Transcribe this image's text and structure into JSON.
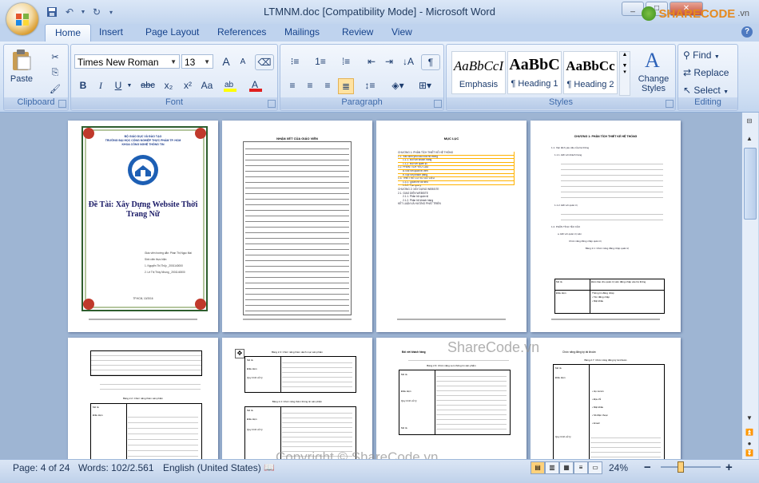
{
  "window": {
    "title": "LTMNM.doc [Compatibility Mode] - Microsoft Word",
    "min": "_",
    "max": "□",
    "close": "✕"
  },
  "watermark": {
    "logo_text": "SHARECODE",
    "logo_suffix": ".vn",
    "center": "ShareCode.vn",
    "copyright": "Copyright © ShareCode.vn"
  },
  "tabs": [
    "Home",
    "Insert",
    "Page Layout",
    "References",
    "Mailings",
    "Review",
    "View"
  ],
  "ribbon": {
    "clipboard": {
      "paste": "Paste",
      "label": "Clipboard"
    },
    "font": {
      "name": "Times New Roman",
      "size": "13",
      "label": "Font",
      "bold": "B",
      "italic": "I",
      "underline": "U",
      "strike": "abc",
      "sub": "x₂",
      "sup": "x²",
      "case": "Aa",
      "grow": "A",
      "shrink": "A"
    },
    "paragraph": {
      "label": "Paragraph"
    },
    "styles": {
      "label": "Styles",
      "items": [
        {
          "preview": "AaBbCcI",
          "name": "Emphasis"
        },
        {
          "preview": "AaBbC",
          "name": "¶ Heading 1"
        },
        {
          "preview": "AaBbCc",
          "name": "¶ Heading 2"
        }
      ],
      "change": [
        "Change",
        "Styles"
      ]
    },
    "editing": {
      "find": "Find",
      "replace": "Replace",
      "select": "Select",
      "label": "Editing"
    }
  },
  "pages": {
    "cover": {
      "ministry": "BỘ GIÁO DỤC VÀ ĐÀO TẠO",
      "school": "TRƯỜNG ĐẠI HỌC CÔNG NGHIỆP THỰC PHẨM TP. HCM",
      "faculty": "KHOA CÔNG NGHỆ THÔNG TIN",
      "title_1": "Đề Tài: Xây Dựng Website Thời",
      "title_2": "Trang Nữ",
      "teacher": "Giáo viên hướng dẫn: Phan Thị Ngọc Mai",
      "students_label": "Sinh viên thực hiện:",
      "student_1": "1. Nguyễn Thị Thủy _2001140000",
      "student_2": "2. Lê Thị Thúy Nhung _2001140000",
      "footer": "TP.HCM, 10/2016"
    },
    "remarks": {
      "heading": "NHẬN XÉT CỦA GIÁO VIÊN"
    },
    "toc": {
      "heading": "MỤC LỤC",
      "entries": [
        "CHƯƠNG 1: PHÂN TÍCH THIẾT KẾ HỆ THỐNG",
        "1.1. Xác định yêu cầu của hệ thống",
        "1.1.1. Đối với khách hàng",
        "1.1.2. Đối với quản trị",
        "1.2. PHÂN TÍCH YÊU CẦU",
        "a. Đối với quản trị viên",
        "b. Đối với khách hàng",
        "1.3. THIẾT KẾ CƠ SỞ DỮ LIỆU",
        "1.3.1. Quan hệ dữ liệu",
        "1.3.2. Tạo query",
        "CHƯƠNG 2: XÂY DỰNG WEBSITE",
        "2.1. GIAO DIỆN WEBSITE",
        "2.1.1. Phân hệ quản trị",
        "2.1.2. Phân hệ khách hàng",
        "KẾT LUẬN VÀ HƯỚNG PHÁT TRIỂN"
      ]
    },
    "chapter": {
      "heading": "CHƯƠNG 1: PHÂN TÍCH THIẾT KẾ HỆ THỐNG",
      "s1": "1.1. Xác định yêu cầu của hệ thống",
      "s11": "1.1.1. Đối với khách hàng",
      "s12": "1.1.2. Đối với quản trị",
      "s2": "1.2. PHÂN TÍCH YÊU CẦU",
      "s2a": "a. Đối với quản trị viên",
      "usecase": "Chức năng đăng nhập quản trị",
      "table_caption": "Bảng 2.1: Chức năng đăng nhập quản trị",
      "cell_a": "Mô tả",
      "cell_b": "Đảm bảo cho quản trị viên đăng nhập vào hệ thống",
      "cell_c": "Điều kiện",
      "cell_d1": "Thông tin đăng nhập",
      "cell_d2": "• Tên đăng nhập",
      "cell_d3": "• Mật khẩu"
    },
    "p5": {
      "caption": "Bảng 2.2: Chức năng thêm sản phẩm",
      "c1": "Mô tả",
      "c2": "Điều kiện",
      "bullet": "Chức năng xóa sản phẩm"
    },
    "p6": {
      "caption_1": "Bảng 2.3: Chức năng thêm danh mục sản phẩm",
      "caption_2": "Bảng 2.4: Chức năng thêm thông tin sản phẩm",
      "c1": "Mô tả",
      "c2": "Điều kiện",
      "c3": "Quy trình xử lý"
    },
    "p7": {
      "bullet": "Đối với khách hàng",
      "caption": "Bảng 2.6: Chức năng xem thông tin sản phẩm",
      "c1": "Mô tả",
      "c2": "Điều kiện",
      "c3": "Quy trình xử lý"
    },
    "p8": {
      "bullet": "Chức năng đăng ký tài khoản",
      "caption": "Bảng 2.7: Chức năng đăng ký tài khoản",
      "c1": "Mô tả",
      "c2": "Điều kiện",
      "c3": "Quy trình xử lý",
      "items": [
        "• Họ và tên",
        "• Địa chỉ",
        "• Mật khẩu",
        "• Số điện thoại",
        "• Email"
      ]
    }
  },
  "status": {
    "page": "Page: 4 of 24",
    "words": "Words: 102/2.561",
    "language": "English (United States)",
    "zoom": "24%",
    "zoom_minus": "−",
    "zoom_plus": "+"
  }
}
